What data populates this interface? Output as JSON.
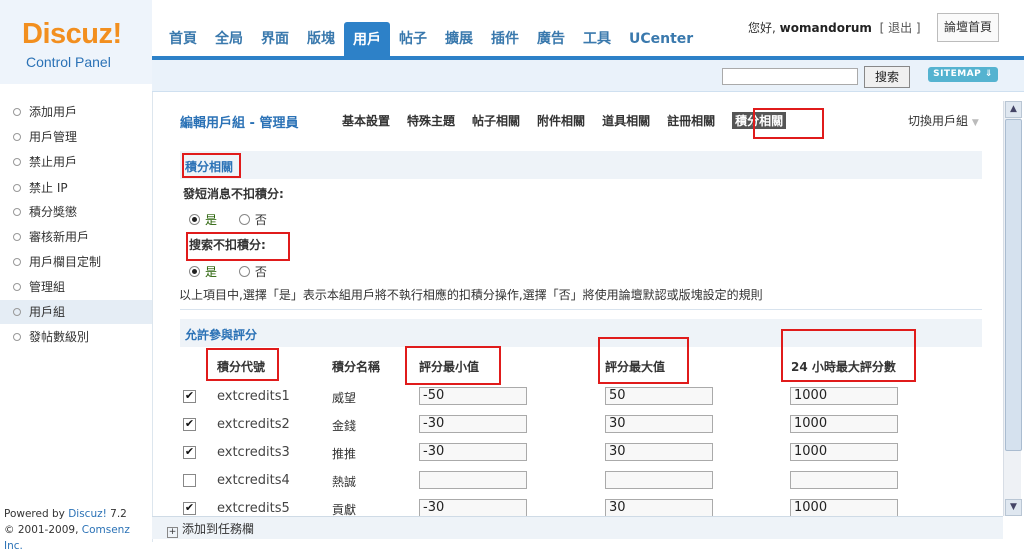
{
  "logo": {
    "main": "Discuz!",
    "sub": "Control Panel"
  },
  "nav": [
    {
      "label": "首頁"
    },
    {
      "label": "全局"
    },
    {
      "label": "界面"
    },
    {
      "label": "版塊"
    },
    {
      "label": "用戶",
      "active": true
    },
    {
      "label": "帖子"
    },
    {
      "label": "擴展"
    },
    {
      "label": "插件"
    },
    {
      "label": "廣告"
    },
    {
      "label": "工具"
    },
    {
      "label": "UCenter"
    }
  ],
  "user": {
    "greeting": "您好,",
    "name": "womandorum",
    "logout": "[ 退出 ]"
  },
  "home_button": "論壇首頁",
  "search": {
    "button": "搜索",
    "sitemap": "SITEMAP ⇓"
  },
  "sidebar": {
    "items": [
      "添加用戶",
      "用戶管理",
      "禁止用戶",
      "禁止 IP",
      "積分獎懲",
      "審核新用戶",
      "用戶欄目定制",
      "管理組",
      "用戶組",
      "發帖數級別"
    ],
    "active_index": 8
  },
  "footer": {
    "powered_prefix": "Powered by ",
    "product": "Discuz!",
    "version": " 7.2",
    "copyright_prefix": "© 2001-2009, ",
    "company": "Comsenz Inc."
  },
  "bottom_bar": {
    "add_task": "添加到任務欄"
  },
  "main": {
    "title": "編輯用戶組 - 管理員",
    "tabs": [
      "基本設置",
      "特殊主題",
      "帖子相關",
      "附件相關",
      "道具相關",
      "註冊相關",
      "積分相關"
    ],
    "active_tab": 6,
    "switch_group": "切換用戶組",
    "section1_title": "積分相關",
    "q1": "發短消息不扣積分:",
    "q2": "搜索不扣積分:",
    "yes": "是",
    "no": "否",
    "note": "以上項目中,選擇「是」表示本組用戶將不執行相應的扣積分操作,選擇「否」將使用論壇默認或版塊設定的規則",
    "section2_title": "允許參與評分",
    "columns": {
      "code": "積分代號",
      "name": "積分名稱",
      "min": "評分最小值",
      "max": "評分最大值",
      "limit": "24 小時最大評分數"
    },
    "rows": [
      {
        "checked": true,
        "code": "extcredits1",
        "name": "威望",
        "min": "-50",
        "max": "50",
        "limit": "1000"
      },
      {
        "checked": true,
        "code": "extcredits2",
        "name": "金錢",
        "min": "-30",
        "max": "30",
        "limit": "1000"
      },
      {
        "checked": true,
        "code": "extcredits3",
        "name": "推推",
        "min": "-30",
        "max": "30",
        "limit": "1000"
      },
      {
        "checked": false,
        "code": "extcredits4",
        "name": "熱誠",
        "min": "",
        "max": "",
        "limit": ""
      },
      {
        "checked": true,
        "code": "extcredits5",
        "name": "貢獻",
        "min": "-30",
        "max": "30",
        "limit": "1000"
      }
    ]
  }
}
